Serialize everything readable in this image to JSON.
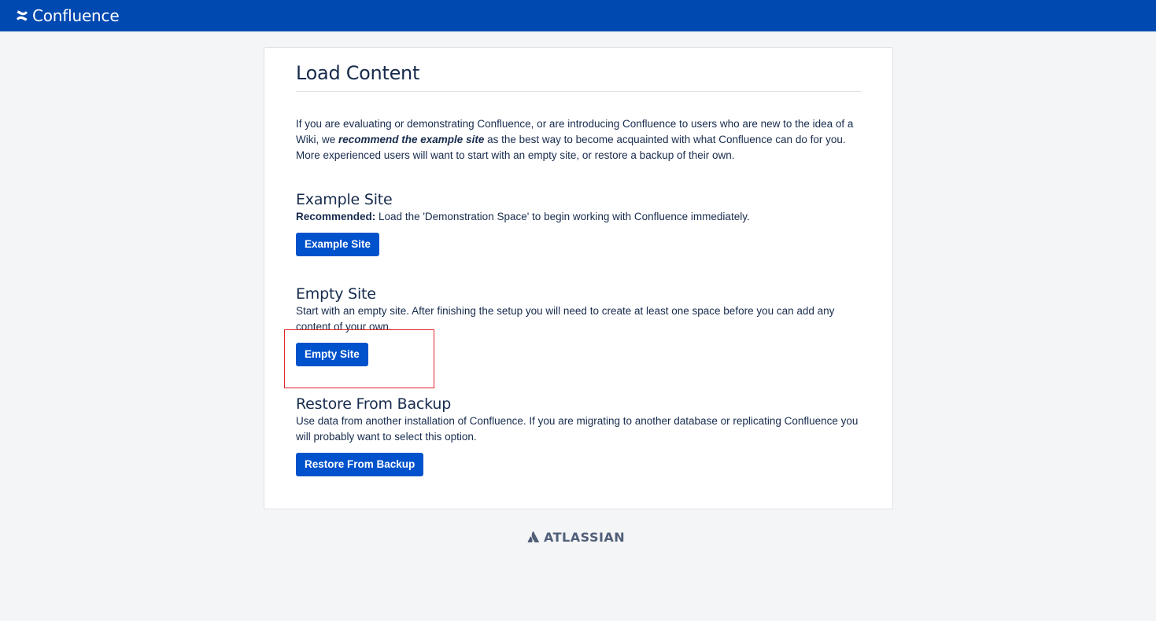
{
  "header": {
    "app_name": "Confluence",
    "icon": "confluence-logo-icon"
  },
  "page": {
    "title": "Load Content",
    "intro_before": "If you are evaluating or demonstrating Confluence, or are introducing Confluence to users who are new to the idea of a Wiki, we ",
    "intro_bold": "recommend the example site",
    "intro_after": " as the best way to become acquainted with what Confluence can do for you. More experienced users will want to start with an empty site, or restore a backup of their own."
  },
  "sections": {
    "example": {
      "title": "Example Site",
      "desc_bold": "Recommended:",
      "desc": " Load the 'Demonstration Space' to begin working with Confluence immediately.",
      "button": "Example Site"
    },
    "empty": {
      "title": "Empty Site",
      "desc": "Start with an empty site. After finishing the setup you will need to create at least one space before you can add any content of your own.",
      "button": "Empty Site"
    },
    "restore": {
      "title": "Restore From Backup",
      "desc": "Use data from another installation of Confluence. If you are migrating to another database or replicating Confluence you will probably want to select this option.",
      "button": "Restore From Backup"
    }
  },
  "footer": {
    "brand": "ATLASSIAN",
    "icon": "atlassian-logo-icon"
  },
  "colors": {
    "header_bg": "#0049b0",
    "primary_button": "#0052cc",
    "page_bg": "#f4f5f7",
    "highlight": "#e0252a"
  }
}
